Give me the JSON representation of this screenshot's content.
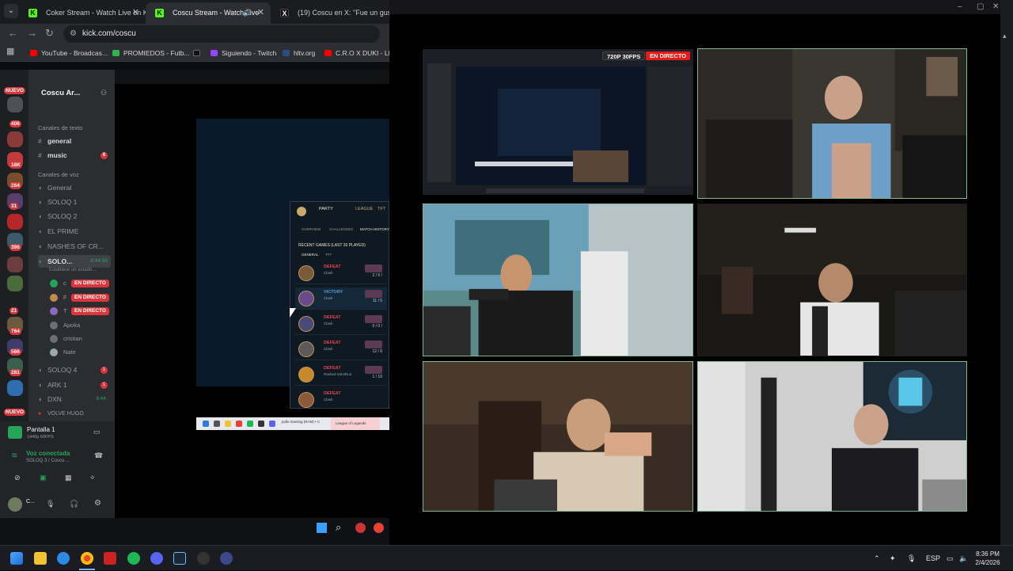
{
  "browser": {
    "tabs": [
      {
        "title": "Coker Stream - Watch Live on K",
        "favicon": "k"
      },
      {
        "title": "Coscu Stream - Watch Live",
        "favicon": "k",
        "active": true
      },
      {
        "title": "(19) Coscu en X: \"Fue un gusto",
        "favicon": "x"
      }
    ],
    "url": "kick.com/coscu",
    "bookmarks": [
      {
        "label": "YouTube - Broadcas...",
        "color": "#ff0000"
      },
      {
        "label": "PROMIEDOS - Futb...",
        "color": "#2fb34a"
      },
      {
        "label": "",
        "color": "#111111"
      },
      {
        "label": "Siguiendo - Twitch",
        "color": "#9146ff"
      },
      {
        "label": "hltv.org",
        "color": "#2b4c7e"
      },
      {
        "label": "C.R.O X DUKI - LEX",
        "color": "#ff0000"
      }
    ]
  },
  "discord": {
    "server_name": "Coscu Ar...",
    "server_badges": [
      "NUEVO",
      "406",
      "18K",
      "264",
      "31",
      "396",
      "21",
      "764",
      "566",
      "281",
      "NUEVO"
    ],
    "text_category": "Canales de texto",
    "text_channels": [
      {
        "name": "general",
        "unread": true
      },
      {
        "name": "music",
        "count": "6"
      }
    ],
    "voice_category": "Canales de voz",
    "voice_channels": [
      "General",
      "SOLOQ 1",
      "SOLOQ 2",
      "EL PRIME",
      "NASHES OF CR..."
    ],
    "active_voice": {
      "name": "SOLO...",
      "timer": "8:44:56",
      "status": "Establece un estado..."
    },
    "voice_users": [
      {
        "name": "c",
        "live": "EN DIRECTO"
      },
      {
        "name": "F",
        "live": "EN DIRECTO"
      },
      {
        "name": "T",
        "live": "EN DIRECTO"
      },
      {
        "name": "Apoka"
      },
      {
        "name": "cristian"
      },
      {
        "name": "Nate"
      }
    ],
    "more_channels": [
      {
        "name": "SOLOQ 4",
        "count": "1"
      },
      {
        "name": "ARK 1",
        "count": "1"
      },
      {
        "name": "DXN",
        "timer": "8:44"
      },
      {
        "name": "VOLVE HUGO"
      }
    ],
    "screen_share": {
      "title": "Pantalla 1",
      "sub": "1440p 60FPS"
    },
    "voice_connected": {
      "title": "Voz conectada",
      "sub": "SOLOQ 3 / Coscu ..."
    },
    "username": "C..."
  },
  "lol_client": {
    "tabs": [
      "PARTY",
      "LEAGUE",
      "TFT"
    ],
    "subtabs": [
      "OVERVIEW",
      "CHALLENGES",
      "MATCH HISTORY"
    ],
    "section": "RECENT GAMES (LAST 20 PLAYED)",
    "filters": [
      "GENERAL",
      "TFT"
    ],
    "games": [
      {
        "result": "DEFEAT",
        "mode": "Clash",
        "kda": "2 / 5 /",
        "color": "#e84057"
      },
      {
        "result": "VICTORY",
        "mode": "Clash",
        "kda": "11 / 5",
        "color": "#5a9fd9"
      },
      {
        "result": "DEFEAT",
        "mode": "Clash",
        "kda": "0 / 0 /",
        "color": "#e84057"
      },
      {
        "result": "DEFEAT",
        "mode": "Clash",
        "kda": "12 / 6",
        "color": "#e84057"
      },
      {
        "result": "DEFEAT",
        "mode": "Ranked Solo/Duo",
        "kda": "1 / 10",
        "color": "#e84057"
      },
      {
        "result": "DEFEAT",
        "mode": "Clash",
        "kda": "",
        "color": "#e84057"
      }
    ],
    "task_items": [
      "pollo Gaming (RAM) • C",
      "League of Legends"
    ]
  },
  "stream": {
    "quality": "720P 30FPS",
    "live": "EN DIRECTO",
    "accent": "#53fc18",
    "live_color": "#e91916"
  },
  "taskbar": {
    "lang": "ESP",
    "time": "8:36 PM",
    "date": "2/4/2026"
  }
}
